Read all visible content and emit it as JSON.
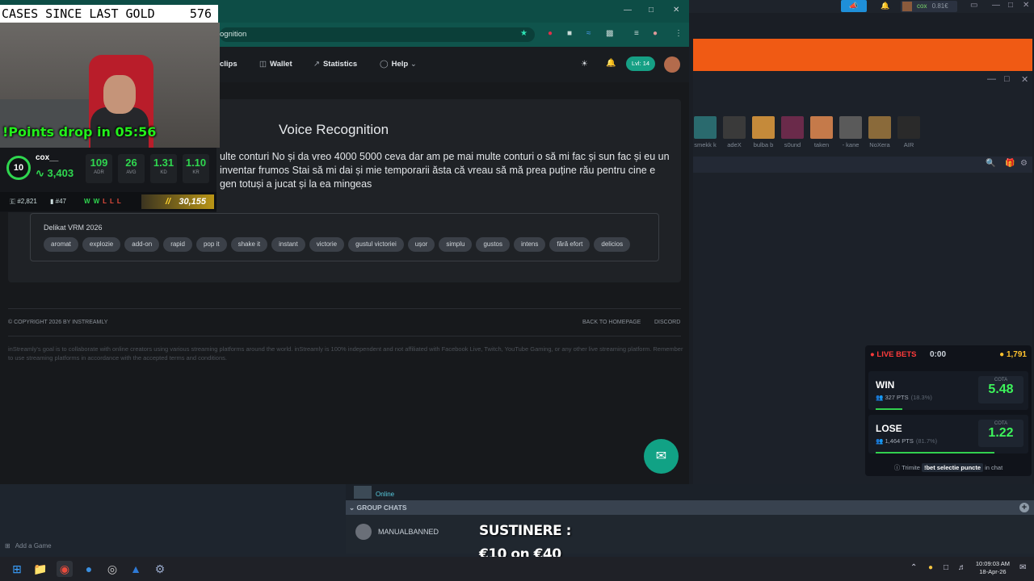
{
  "overlay": {
    "cases_label": "CASES SINCE LAST GOLD",
    "cases_count": "576",
    "points_drop": "!Points drop in 05:56",
    "stats": {
      "level": "10",
      "username": "cox__",
      "elo": "3,403",
      "boxes": [
        {
          "value": "109",
          "key": "ADR"
        },
        {
          "value": "26",
          "key": "AVG"
        },
        {
          "value": "1.31",
          "key": "KD"
        },
        {
          "value": "1.10",
          "key": "KR"
        }
      ],
      "eu_rank": "#2,821",
      "country_rank": "#47",
      "form": [
        "W",
        "W",
        "L",
        "L",
        "L"
      ],
      "points": "30,155"
    },
    "sustinere_title": "SUSTINERE :",
    "sustinere_amount": "€10 on €40"
  },
  "browser": {
    "url_fragment": "ognition",
    "nav": [
      {
        "label": "clips",
        "icon": "clip-icon"
      },
      {
        "label": "Wallet",
        "icon": "wallet-icon"
      },
      {
        "label": "Statistics",
        "icon": "chart-icon"
      },
      {
        "label": "Help",
        "icon": "help-icon"
      }
    ],
    "level_badge": "Lvl: 14",
    "page_title": "Voice Recognition",
    "transcript": "ulte conturi No și da vreo 4000 5000 ceva dar am pe mai multe conturi o să mi fac și sun fac și eu un inventar frumos Stai să mi dai și mie temporarii ăsta că vreau să mă prea puține rău pentru cine e gen totuși a jucat și la ea mingeas",
    "preset_title": "Delikat VRM 2026",
    "tags": [
      "aromat",
      "explozie",
      "add-on",
      "rapid",
      "pop it",
      "shake it",
      "instant",
      "victorie",
      "gustul victoriei",
      "ușor",
      "simplu",
      "gustos",
      "intens",
      "fără efort",
      "delicios"
    ],
    "copyright": "© COPYRIGHT 2026 BY INSTREAMLY",
    "back_home": "BACK TO HOMEPAGE",
    "discord": "DISCORD",
    "disclaimer": "inStreamly's goal is to collaborate with online creators using various streaming platforms around the world. inStreamly is 100% independent and not affiliated with Facebook Live, Twitch, YouTube Gaming, or any other live streaming platform. Remember to use streaming platforms in accordance with the accepted terms and conditions."
  },
  "steam": {
    "user_chip": "cox",
    "user_points": "0.81€",
    "friends": [
      {
        "name": "smekk k",
        "color": "#2a6a6e"
      },
      {
        "name": "adeX",
        "color": "#3a3a3a"
      },
      {
        "name": "bulba b",
        "color": "#c58a3a"
      },
      {
        "name": "s0und",
        "color": "#6a2a4a"
      },
      {
        "name": "taken",
        "color": "#c57a4a"
      },
      {
        "name": "- kane",
        "color": "#5a5a5a"
      },
      {
        "name": "NoXera",
        "color": "#8a6a3a"
      },
      {
        "name": "AIR",
        "color": "#2a2a2a"
      }
    ],
    "online_status": "Online",
    "group_chats": "GROUP CHATS",
    "group_name": "MANUALBANNED",
    "add_game": "Add a Game"
  },
  "bets": {
    "live_label": "LIVE BETS",
    "timer": "0:00",
    "coins": "1,791",
    "options": [
      {
        "label": "WIN",
        "pts": "327 PTS",
        "pct": "(18.3%)",
        "cota_label": "COTA",
        "cota": "5.48",
        "fill": 0.183
      },
      {
        "label": "LOSE",
        "pts": "1,464 PTS",
        "pct": "(81.7%)",
        "cota_label": "COTA",
        "cota": "1.22",
        "fill": 0.817
      }
    ],
    "foot_prefix": "Trimite",
    "foot_cmd": "!bet selectie puncte",
    "foot_suffix": "in chat"
  },
  "taskbar": {
    "time": "10:09:03 AM",
    "date": "18-Apr-26"
  },
  "colors": {
    "accent": "#11a285",
    "browser_chrome": "#0f544c",
    "win": "#3df55b",
    "live": "#ff3b3b"
  }
}
